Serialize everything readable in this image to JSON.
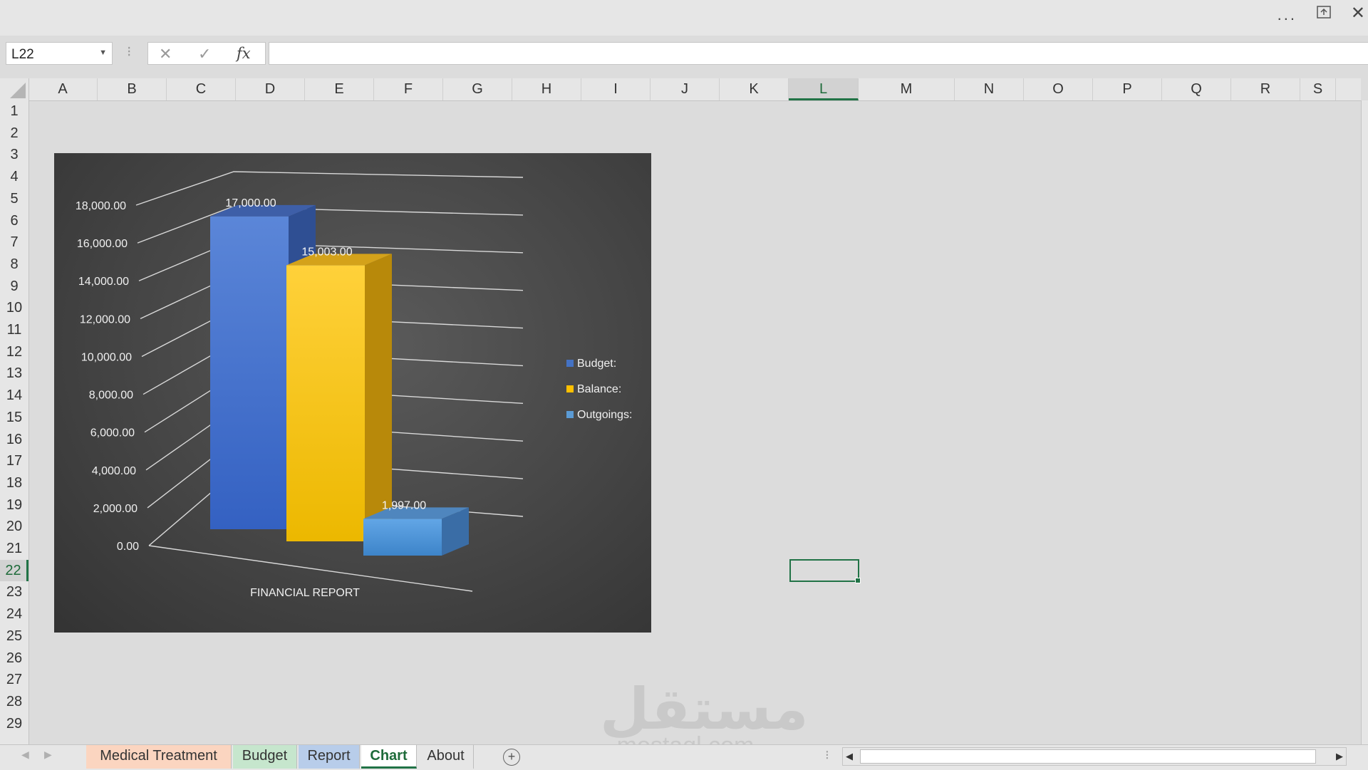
{
  "window": {
    "more_label": "...",
    "close_label": "✕"
  },
  "formula_bar": {
    "name_box": "L22",
    "cancel_glyph": "✕",
    "enter_glyph": "✓",
    "fx_label": "fx",
    "formula": ""
  },
  "grid": {
    "columns": [
      "A",
      "B",
      "C",
      "D",
      "E",
      "F",
      "G",
      "H",
      "I",
      "J",
      "K",
      "L",
      "M",
      "N",
      "O",
      "P",
      "Q",
      "R",
      "S"
    ],
    "rows": [
      "1",
      "2",
      "3",
      "4",
      "5",
      "6",
      "7",
      "8",
      "9",
      "10",
      "11",
      "12",
      "13",
      "14",
      "15",
      "16",
      "17",
      "18",
      "19",
      "20",
      "21",
      "22",
      "23",
      "24",
      "25",
      "26",
      "27",
      "28",
      "29"
    ],
    "selected_column": "L",
    "selected_row": "22"
  },
  "chart_data": {
    "type": "bar",
    "style": "3d-column",
    "categories": [
      "FINANCIAL REPORT"
    ],
    "series": [
      {
        "name": "Budget:",
        "values": [
          17000
        ],
        "color": "#4472C4",
        "label": "17,000.00"
      },
      {
        "name": "Balance:",
        "values": [
          15003
        ],
        "color": "#FFC000",
        "label": "15,003.00"
      },
      {
        "name": "Outgoings:",
        "values": [
          1997
        ],
        "color": "#5B9BD5",
        "label": "1,997.00"
      }
    ],
    "y_ticks": [
      "0.00",
      "2,000.00",
      "4,000.00",
      "6,000.00",
      "8,000.00",
      "10,000.00",
      "12,000.00",
      "14,000.00",
      "16,000.00",
      "18,000.00"
    ],
    "ylim": [
      0,
      18000
    ],
    "xlabel": "FINANCIAL REPORT",
    "legend": "right",
    "grid": true
  },
  "sheet_tabs": [
    {
      "label": "Medical Treatment",
      "color": "#fbd5c0"
    },
    {
      "label": "Budget",
      "color": "#c6e6cd"
    },
    {
      "label": "Report",
      "color": "#b8cdea"
    },
    {
      "label": "Chart",
      "color": "#ffffff",
      "active": true
    },
    {
      "label": "About",
      "color": ""
    }
  ],
  "add_sheet_glyph": "+",
  "watermark": {
    "arabic": "مستقل",
    "latin": "mostaql.com"
  }
}
